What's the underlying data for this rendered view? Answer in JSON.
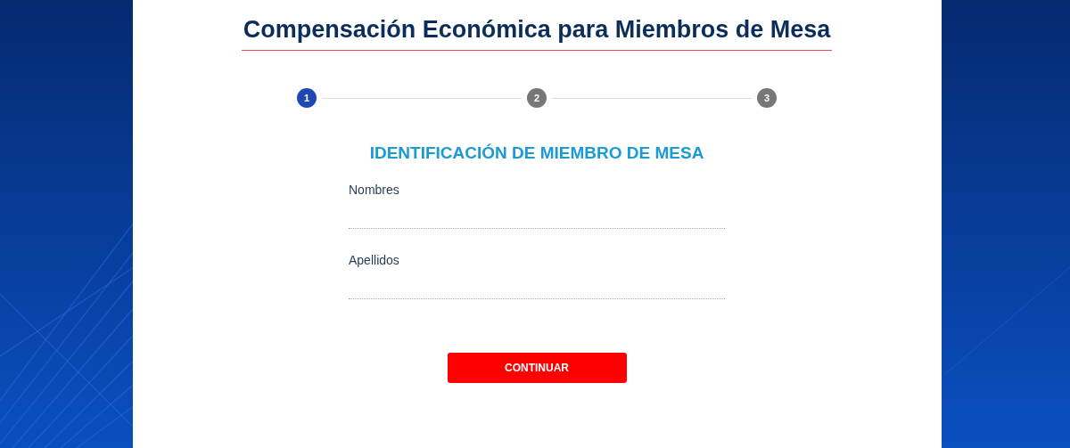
{
  "title": "Compensación Económica para Miembros de Mesa",
  "steps": [
    {
      "label": "1",
      "selected": true
    },
    {
      "label": "2",
      "selected": false
    },
    {
      "label": "3",
      "selected": false
    }
  ],
  "section_title": "IDENTIFICACIÓN DE MIEMBRO DE MESA",
  "fields": [
    {
      "label": "Nombres"
    },
    {
      "label": "Apellidos"
    }
  ],
  "button": "CONTINUAR"
}
